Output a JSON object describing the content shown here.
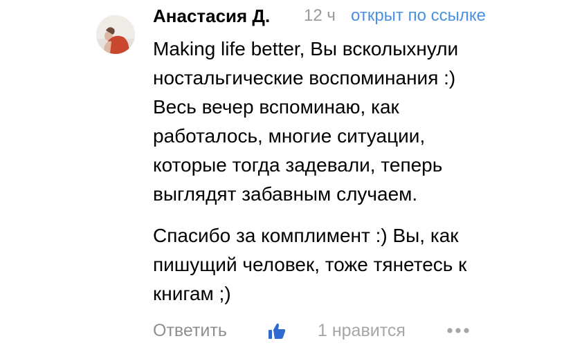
{
  "comment": {
    "author": "Анастасия Д.",
    "time": "12 ч",
    "opened_via": "открыт по ссылке",
    "paragraph1": [
      "Making life better, Вы всколыхнули",
      "ностальгические воспоминания :)",
      "Весь вечер вспоминаю, как",
      "работалось, многие ситуации,",
      "которые тогда задевали, теперь",
      "выглядят забавным случаем."
    ],
    "paragraph2": [
      "Спасибо за комплимент :) Вы, как",
      "пишущий человек, тоже тянетесь к",
      "книгам ;)"
    ]
  },
  "actions": {
    "reply_label": "Ответить",
    "likes_label": "1 нравится"
  },
  "colors": {
    "like_icon": "#2f6ad1",
    "link": "#4a90e2",
    "muted": "#9a9a9a"
  },
  "icons": {
    "avatar": "user-avatar-photo",
    "like": "thumbs-up-icon",
    "more": "more-dots-icon"
  }
}
